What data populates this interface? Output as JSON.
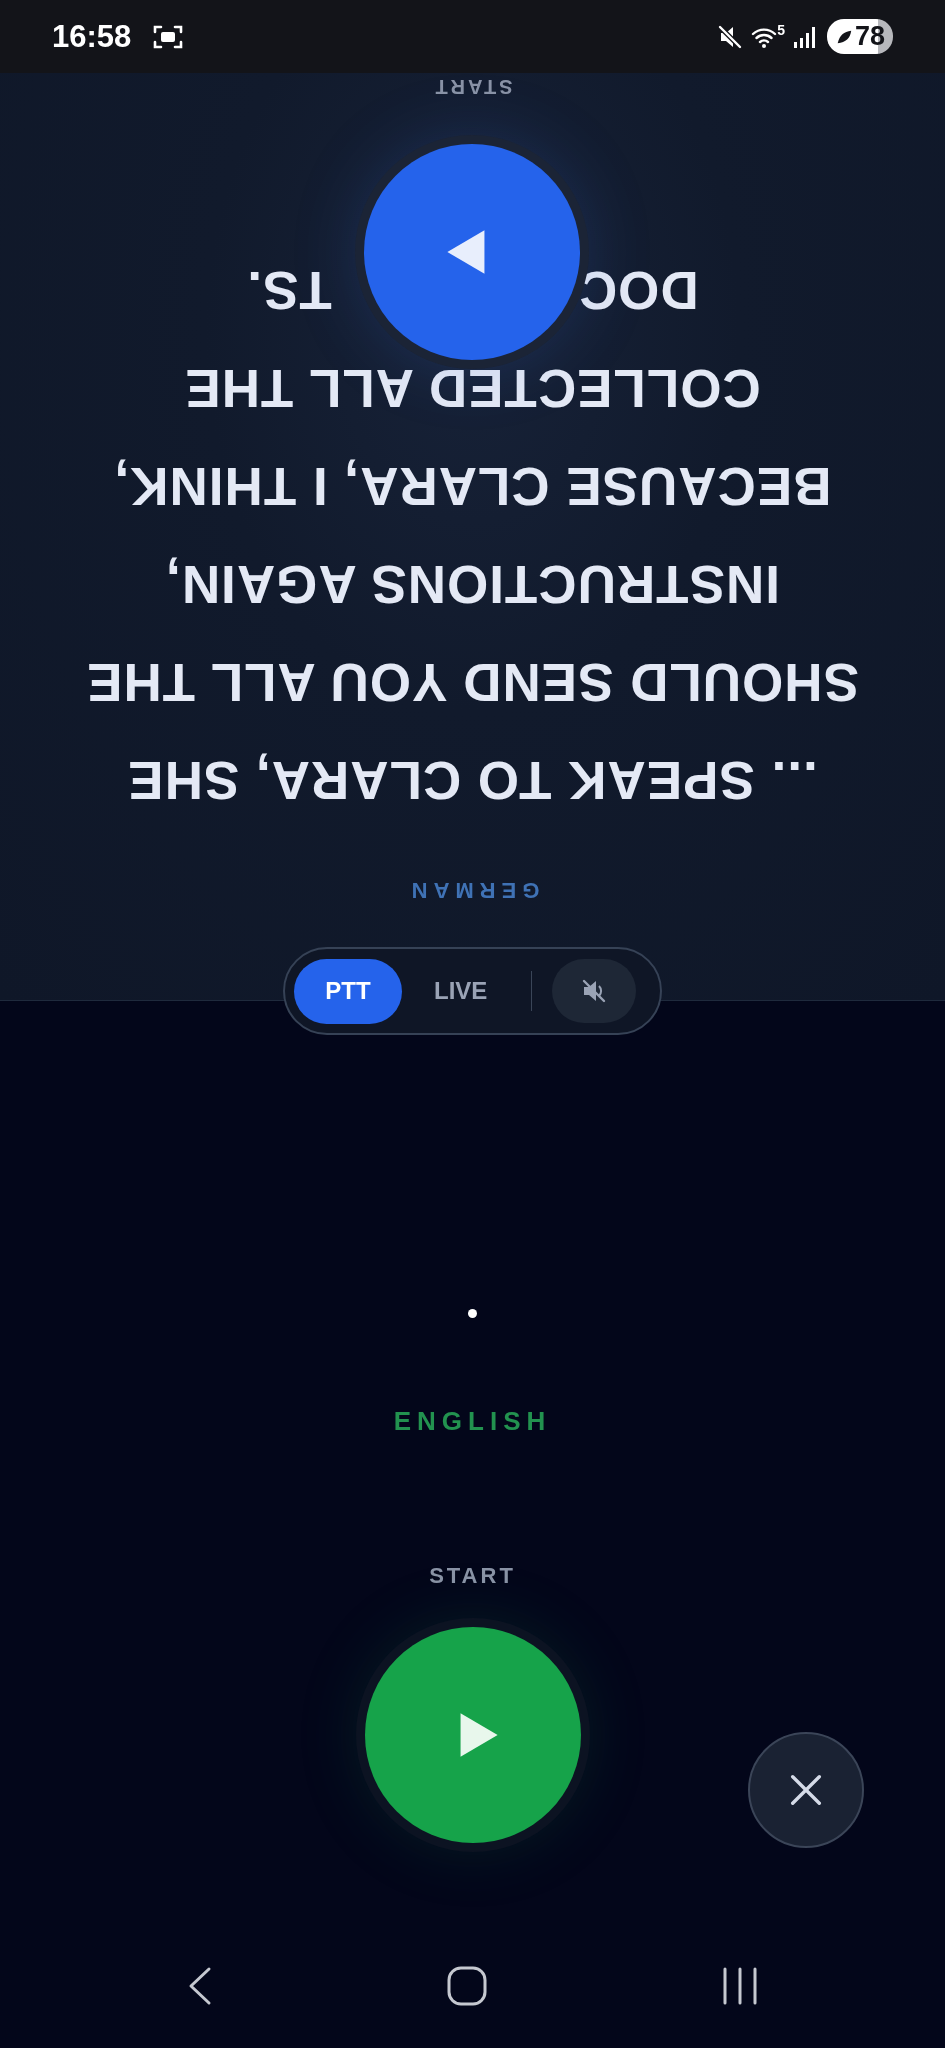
{
  "status_bar": {
    "time": "16:58",
    "network_band": "5",
    "battery": "78"
  },
  "partner_panel": {
    "start_label": "START",
    "caption_lines": [
      "... SPEAK TO CLARA, SHE",
      "SHOULD SEND YOU ALL THE",
      "INSTRUCTIONS AGAIN,",
      "BECAUSE CLARA, I THINK,",
      "COLLECTED ALL THE"
    ],
    "covered_line_parts": [
      "DOC",
      "TS."
    ],
    "language": "GERMAN"
  },
  "mode_switch": {
    "modes": [
      {
        "label": "PTT",
        "selected": true
      },
      {
        "label": "LIVE",
        "selected": false
      }
    ]
  },
  "own_panel": {
    "language": "ENGLISH",
    "start_label": "START"
  }
}
